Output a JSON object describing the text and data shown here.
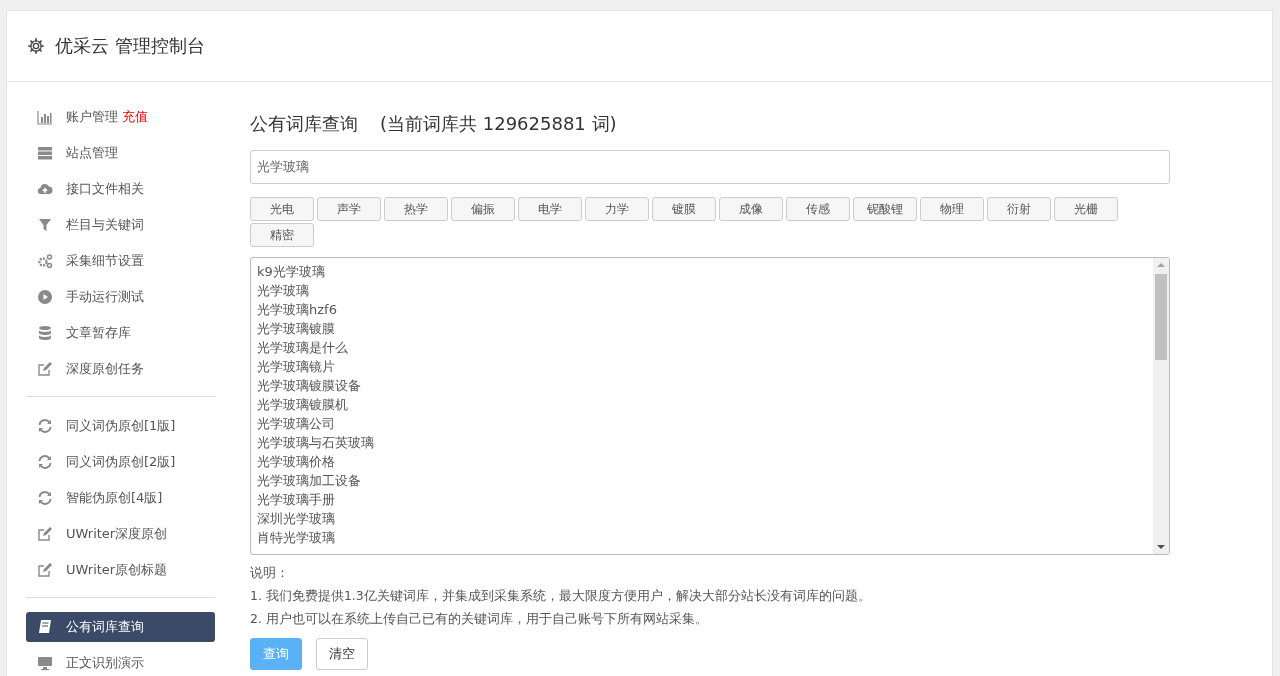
{
  "header": {
    "title": "优采云 管理控制台"
  },
  "sidebar": {
    "sections": [
      [
        {
          "label": "账户管理",
          "badge": "充值",
          "selected": false
        },
        {
          "label": "站点管理",
          "selected": false
        },
        {
          "label": "接口文件相关",
          "selected": false
        },
        {
          "label": "栏目与关键词",
          "selected": false
        },
        {
          "label": "采集细节设置",
          "selected": false
        },
        {
          "label": "手动运行测试",
          "selected": false
        },
        {
          "label": "文章暂存库",
          "selected": false
        },
        {
          "label": "深度原创任务",
          "selected": false
        }
      ],
      [
        {
          "label": "同义词伪原创[1版]",
          "selected": false
        },
        {
          "label": "同义词伪原创[2版]",
          "selected": false
        },
        {
          "label": "智能伪原创[4版]",
          "selected": false
        },
        {
          "label": "UWriter深度原创",
          "selected": false
        },
        {
          "label": "UWriter原创标题",
          "selected": false
        }
      ],
      [
        {
          "label": "公有词库查询",
          "selected": true
        },
        {
          "label": "正文识别演示",
          "selected": false
        }
      ]
    ]
  },
  "main": {
    "title": "公有词库查询",
    "subtitle": "(当前词库共 129625881 词)",
    "search": {
      "value": "光学玻璃"
    },
    "tags": [
      "光电",
      "声学",
      "热学",
      "偏振",
      "电学",
      "力学",
      "镀膜",
      "成像",
      "传感",
      "铌酸锂",
      "物理",
      "衍射",
      "光栅",
      "精密"
    ],
    "results": [
      "k9光学玻璃",
      "光学玻璃",
      "光学玻璃hzf6",
      "光学玻璃镀膜",
      "光学玻璃是什么",
      "光学玻璃镜片",
      "光学玻璃镀膜设备",
      "光学玻璃镀膜机",
      "光学玻璃公司",
      "光学玻璃与石英玻璃",
      "光学玻璃价格",
      "光学玻璃加工设备",
      "光学玻璃手册",
      "深圳光学玻璃",
      "肖特光学玻璃"
    ],
    "notes_title": "说明：",
    "notes": [
      "1. 我们免费提供1.3亿关键词库，并集成到采集系统，最大限度方便用户，解决大部分站长没有词库的问题。",
      "2. 用户也可以在系统上传自己已有的关键词库，用于自己账号下所有网站采集。"
    ],
    "buttons": [
      {
        "label": "查询",
        "kind": "primary"
      },
      {
        "label": "清空",
        "kind": "default"
      }
    ]
  }
}
